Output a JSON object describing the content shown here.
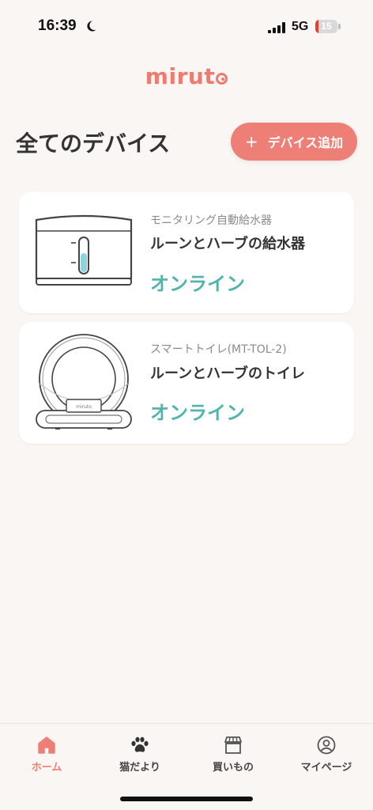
{
  "status_bar": {
    "time": "16:39",
    "network": "5G",
    "battery_level": 15,
    "battery_label": "15"
  },
  "logo": {
    "text_prefix": "mirut"
  },
  "header": {
    "title": "全てのデバイス",
    "add_button_label": "デバイス追加",
    "add_icon": "+"
  },
  "devices": [
    {
      "type": "モニタリング自動給水器",
      "name": "ルーンとハーブの給水器",
      "status": "オンライン",
      "icon": "water-fountain-icon"
    },
    {
      "type": "スマートトイレ(MT-TOL-2)",
      "name": "ルーンとハーブのトイレ",
      "status": "オンライン",
      "icon": "smart-toilet-icon"
    }
  ],
  "device_toilet_brand": "miruto",
  "tabs": [
    {
      "label": "ホーム",
      "icon": "home-icon",
      "active": true
    },
    {
      "label": "猫だより",
      "icon": "paw-icon",
      "active": false
    },
    {
      "label": "買いもの",
      "icon": "shop-icon",
      "active": false
    },
    {
      "label": "マイページ",
      "icon": "profile-icon",
      "active": false
    }
  ],
  "colors": {
    "accent": "#ee7f76",
    "online": "#4fb5ac",
    "background": "#faf6f3",
    "battery_low": "#ea3b2f"
  }
}
